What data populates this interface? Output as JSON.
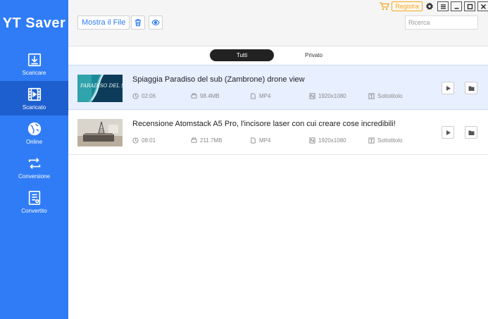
{
  "app": {
    "title": "YT Saver"
  },
  "sidebar": {
    "items": [
      {
        "label": "Scaricare",
        "icon": "download-icon",
        "active": false
      },
      {
        "label": "Scaricato",
        "icon": "film-icon",
        "active": true
      },
      {
        "label": "Online",
        "icon": "globe-icon",
        "active": false
      },
      {
        "label": "Conversione",
        "icon": "convert-icon",
        "active": false
      },
      {
        "label": "Convertito",
        "icon": "document-icon",
        "active": false
      }
    ]
  },
  "toolbar": {
    "show_file_label": "Mostra il File",
    "register_label": "Registra",
    "search_placeholder": "Ricerca"
  },
  "tabs": [
    {
      "label": "Tutti",
      "active": true
    },
    {
      "label": "Privato",
      "active": false
    }
  ],
  "videos": [
    {
      "title": "Spiaggia Paradiso del sub (Zambrone) drone view",
      "duration": "02:06",
      "size": "98.4MB",
      "format": "MP4",
      "resolution": "1920x1080",
      "subtitle": "Sottotitolo",
      "thumb_text": "PARADISO DEL SUB",
      "selected": true
    },
    {
      "title": "Recensione Atomstack A5 Pro, l'incisore laser con cui creare cose incredibili!",
      "duration": "08:01",
      "size": "211.7MB",
      "format": "MP4",
      "resolution": "1920x1080",
      "subtitle": "Sottotitolo",
      "selected": false
    }
  ],
  "colors": {
    "primary": "#2f7cf6",
    "sidebar_active": "#1e5fd0",
    "register_accent": "#f5a623",
    "selected_row": "#e8efff"
  }
}
